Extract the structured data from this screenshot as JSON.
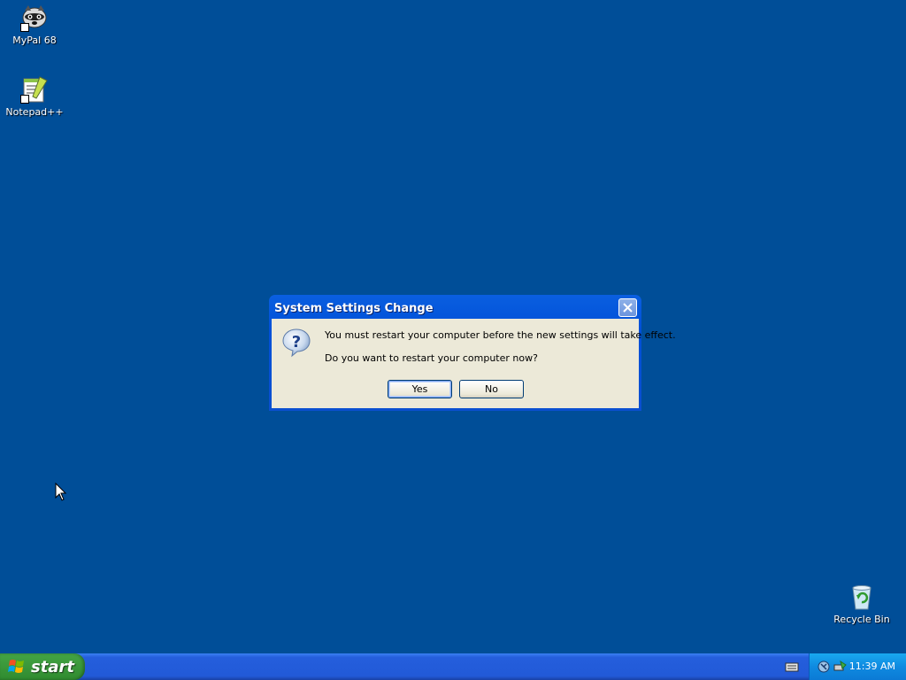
{
  "desktop": {
    "icons": [
      {
        "label": "MyPal 68",
        "icon": "mypal-icon"
      },
      {
        "label": "Notepad++",
        "icon": "notepadpp-icon"
      },
      {
        "label": "Recycle Bin",
        "icon": "recycle-bin-icon"
      }
    ]
  },
  "dialog": {
    "title": "System Settings Change",
    "message": "You must restart your computer before the new settings will take effect.",
    "question": "Do you want to restart your computer now?",
    "yes_label": "Yes",
    "no_label": "No",
    "icon": "question-icon"
  },
  "taskbar": {
    "start_label": "start",
    "clock": "11:39 AM",
    "tray_icons": [
      "keyboard-icon",
      "network-icon",
      "safely-remove-icon"
    ]
  },
  "colors": {
    "desktop": "#004e98",
    "titlebar": "#0050d8",
    "dialog_body": "#ece9d8",
    "start_button": "#3c9a3c",
    "taskbar": "#245edc",
    "tray": "#0f8ae0"
  }
}
